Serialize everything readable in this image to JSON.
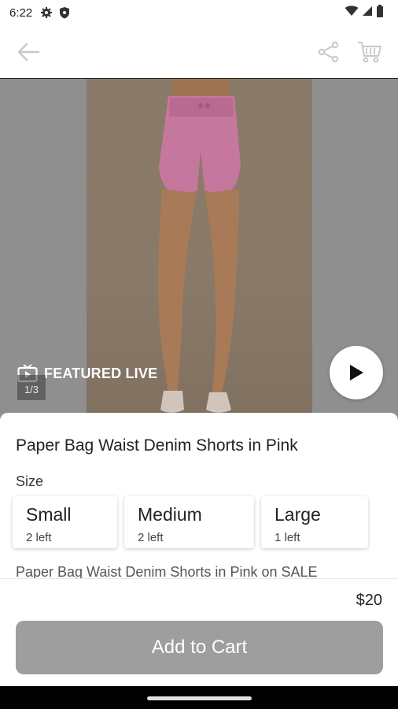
{
  "status_bar": {
    "time": "6:22",
    "icons": [
      "settings-icon",
      "shield-icon",
      "wifi-icon",
      "signal-icon",
      "battery-icon"
    ]
  },
  "toolbar": {
    "back_icon": "arrow-left-icon",
    "share_icon": "share-icon",
    "cart_icon": "cart-icon"
  },
  "hero": {
    "featured_label": "FEATURED LIVE",
    "counter": "1/3",
    "play_icon": "play-icon"
  },
  "product": {
    "title": "Paper Bag Waist Denim Shorts in Pink",
    "size_label": "Size",
    "sizes": [
      {
        "name": "Small",
        "left": "2 left"
      },
      {
        "name": "Medium",
        "left": "2 left"
      },
      {
        "name": "Large",
        "left": "1 left"
      }
    ],
    "description": "Paper Bag Waist Denim Shorts in Pink on SALE"
  },
  "checkout": {
    "price": "$20",
    "add_to_cart": "Add to Cart"
  },
  "colors": {
    "button_gray": "#9e9e9e",
    "shorts_pink": "#e88fbf"
  }
}
